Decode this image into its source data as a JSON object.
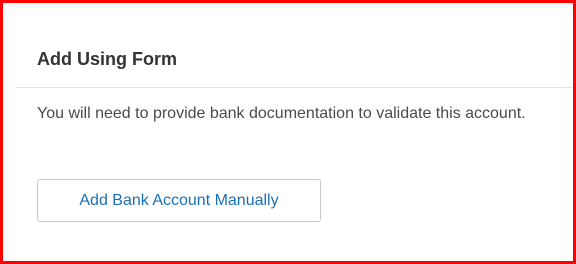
{
  "section": {
    "title": "Add Using Form",
    "description": "You will need to provide bank documentation to validate this account.",
    "button_label": "Add Bank Account Manually"
  },
  "colors": {
    "highlight_border": "#ff0000",
    "title_text": "#333333",
    "body_text": "#4a4a4a",
    "link_text": "#1a6fb5",
    "button_border": "#c9c9c9"
  }
}
